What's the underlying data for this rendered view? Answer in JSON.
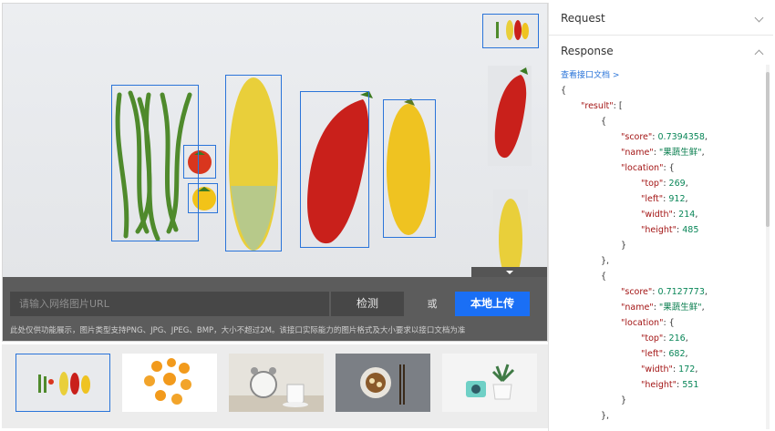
{
  "input": {
    "placeholder": "请输入网络图片URL"
  },
  "buttons": {
    "detect": "检测",
    "or": "或",
    "upload": "本地上传"
  },
  "hint": "此处仅供功能展示，图片类型支持PNG、JPG、JPEG、BMP，大小不超过2M。该接口实际能力的图片格式及大小要求以接口文档为准",
  "panel": {
    "request_title": "Request",
    "response_title": "Response",
    "doc_link": "查看接口文档 >",
    "json": {
      "open_brace": "{",
      "result_key": "\"result\"",
      "result_open": ": [",
      "obj_open": "{",
      "items": [
        {
          "score_key": "\"score\"",
          "score": "0.7394358",
          "name_key": "\"name\"",
          "name": "\"果蔬生鲜\"",
          "location_key": "\"location\"",
          "top_key": "\"top\"",
          "top": "269",
          "left_key": "\"left\"",
          "left": "912",
          "width_key": "\"width\"",
          "width": "214",
          "height_key": "\"height\"",
          "height": "485"
        },
        {
          "score_key": "\"score\"",
          "score": "0.7127773",
          "name_key": "\"name\"",
          "name": "\"果蔬生鲜\"",
          "location_key": "\"location\"",
          "top_key": "\"top\"",
          "top": "216",
          "left_key": "\"left\"",
          "left": "682",
          "width_key": "\"width\"",
          "width": "172",
          "height_key": "\"height\"",
          "height": "551"
        }
      ],
      "obj_close_comma": "},",
      "loc_close": "}"
    }
  },
  "gallery": {
    "items": [
      {
        "name": "vegetables"
      },
      {
        "name": "oranges"
      },
      {
        "name": "alarm-clock-cup"
      },
      {
        "name": "bowl-chopsticks"
      },
      {
        "name": "camera-plant"
      }
    ]
  },
  "colors": {
    "accent": "#1a6ff5",
    "box": "#2a74d9",
    "key": "#a31515",
    "string": "#0a7e4f"
  }
}
